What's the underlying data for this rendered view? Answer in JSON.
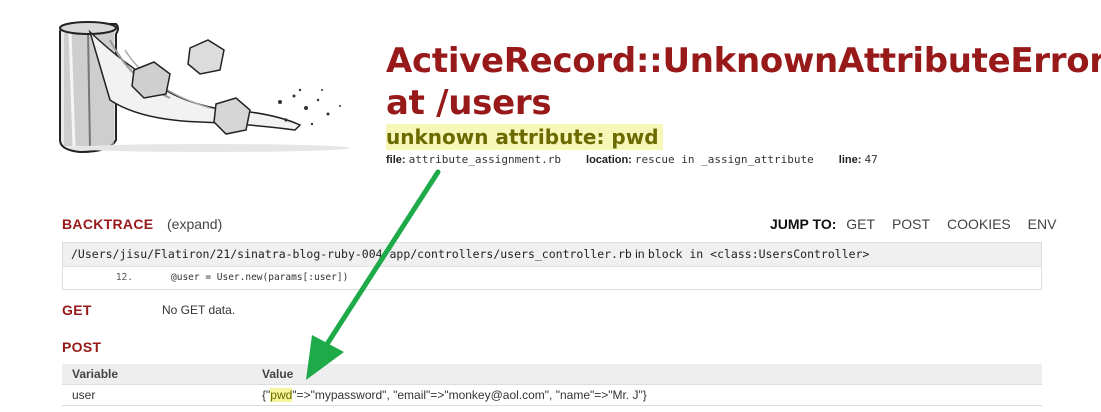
{
  "header": {
    "title": "ActiveRecord::UnknownAttributeError at /users",
    "message": "unknown attribute: pwd",
    "file_label": "file:",
    "file_value": "attribute_assignment.rb",
    "location_label": "location:",
    "location_value": "rescue in _assign_attribute",
    "line_label": "line:",
    "line_value": "47"
  },
  "backtrace": {
    "title": "BACKTRACE",
    "expand_label": "(expand)",
    "frame_path": "/Users/jisu/Flatiron/21/sinatra-blog-ruby-004/app/controllers/users_controller.rb",
    "frame_in": "in",
    "frame_method": "block in <class:UsersController>",
    "line_number": "12.",
    "line_code": "@user = User.new(params[:user])"
  },
  "jump_to": {
    "label": "JUMP TO:",
    "links": [
      "GET",
      "POST",
      "COOKIES",
      "ENV"
    ]
  },
  "get_section": {
    "title": "GET",
    "empty_text": "No GET data."
  },
  "post_section": {
    "title": "POST",
    "columns": [
      "Variable",
      "Value"
    ],
    "rows": [
      {
        "variable": "user",
        "value_prefix": "{\"",
        "value_highlight": "pwd",
        "value_rest": "\"=>\"mypassword\", \"email\"=>\"monkey@aol.com\", \"name\"=>\"Mr. J\"}"
      }
    ]
  },
  "colors": {
    "title": "#981919",
    "highlight_bg": "#f5f59a",
    "arrow": "#1faa4a"
  }
}
